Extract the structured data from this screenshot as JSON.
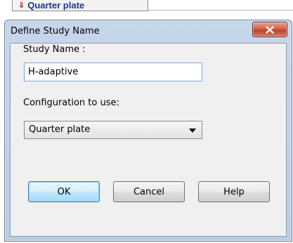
{
  "background_tab": {
    "icon": "quarter-plate-icon",
    "label": "Quarter plate"
  },
  "dialog": {
    "title": "Define Study Name",
    "close_icon": "close-icon",
    "study_name_label": "Study Name :",
    "study_name_value": "H-adaptive",
    "config_label": "Configuration to use:",
    "config_selected": "Quarter plate",
    "buttons": {
      "ok": "OK",
      "cancel": "Cancel",
      "help": "Help"
    }
  },
  "colors": {
    "close_button": "#c0402a",
    "frame": "#b9cde4",
    "tab_text": "#1a3a8a"
  }
}
